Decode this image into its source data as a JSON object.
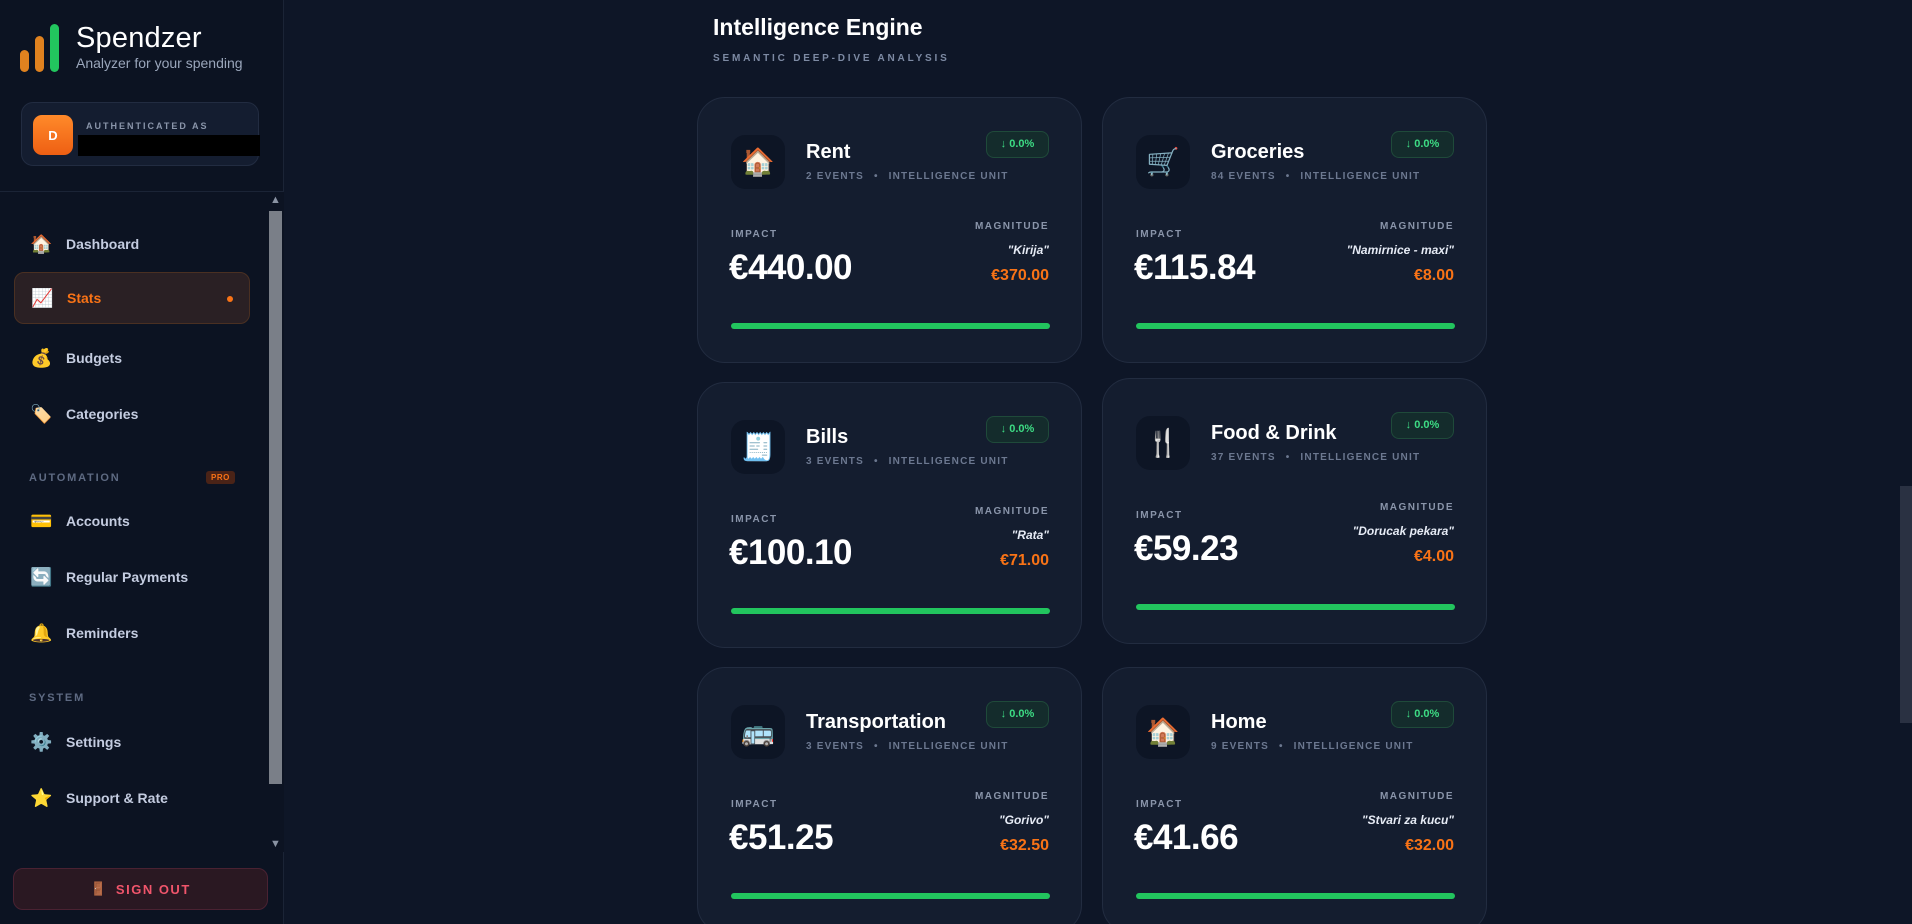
{
  "brand": {
    "name": "Spendzer",
    "tagline": "Analyzer for your spending"
  },
  "user": {
    "initial": "D",
    "auth_label": "AUTHENTICATED AS"
  },
  "nav": {
    "items": [
      {
        "label": "Dashboard",
        "icon": "house-icon"
      },
      {
        "label": "Stats",
        "icon": "chart-icon",
        "active": true
      },
      {
        "label": "Budgets",
        "icon": "money-bag-icon"
      },
      {
        "label": "Categories",
        "icon": "tag-icon"
      }
    ],
    "automation_label": "AUTOMATION",
    "pro_badge": "PRO",
    "automation_items": [
      {
        "label": "Accounts",
        "icon": "credit-card-icon"
      },
      {
        "label": "Regular Payments",
        "icon": "repeat-icon"
      },
      {
        "label": "Reminders",
        "icon": "bell-icon"
      }
    ],
    "system_label": "SYSTEM",
    "system_items": [
      {
        "label": "Settings",
        "icon": "gear-icon"
      },
      {
        "label": "Support & Rate",
        "icon": "star-icon"
      }
    ],
    "signout_label": "SIGN OUT"
  },
  "main": {
    "title": "Intelligence Engine",
    "subtitle": "SEMANTIC DEEP-DIVE ANALYSIS",
    "impact_label": "IMPACT",
    "magnitude_label": "MAGNITUDE",
    "unit_label": "INTELLIGENCE UNIT",
    "categories": [
      {
        "name": "Rent",
        "icon": "house-icon",
        "events": "2 EVENTS",
        "trend": "↓ 0.0%",
        "impact": "€440.00",
        "top_item": "\"Kirija\"",
        "top_value": "€370.00"
      },
      {
        "name": "Groceries",
        "icon": "shopping-cart-icon",
        "events": "84 EVENTS",
        "trend": "↓ 0.0%",
        "impact": "€115.84",
        "top_item": "\"Namirnice - maxi\"",
        "top_value": "€8.00"
      },
      {
        "name": "Bills",
        "icon": "receipt-icon",
        "events": "3 EVENTS",
        "trend": "↓ 0.0%",
        "impact": "€100.10",
        "top_item": "\"Rata\"",
        "top_value": "€71.00"
      },
      {
        "name": "Food & Drink",
        "icon": "fork-knife-icon",
        "events": "37 EVENTS",
        "trend": "↓ 0.0%",
        "impact": "€59.23",
        "top_item": "\"Dorucak pekara\"",
        "top_value": "€4.00"
      },
      {
        "name": "Transportation",
        "icon": "bus-icon",
        "events": "3 EVENTS",
        "trend": "↓ 0.0%",
        "impact": "€51.25",
        "top_item": "\"Gorivo\"",
        "top_value": "€32.50"
      },
      {
        "name": "Home",
        "icon": "house-icon",
        "events": "9 EVENTS",
        "trend": "↓ 0.0%",
        "impact": "€41.66",
        "top_item": "\"Stvari za kucu\"",
        "top_value": "€32.00"
      }
    ]
  },
  "colors": {
    "accent": "#f97316",
    "success": "#22c55e",
    "danger": "#f0556b",
    "background": "#0e1627",
    "card": "#141d2f"
  }
}
